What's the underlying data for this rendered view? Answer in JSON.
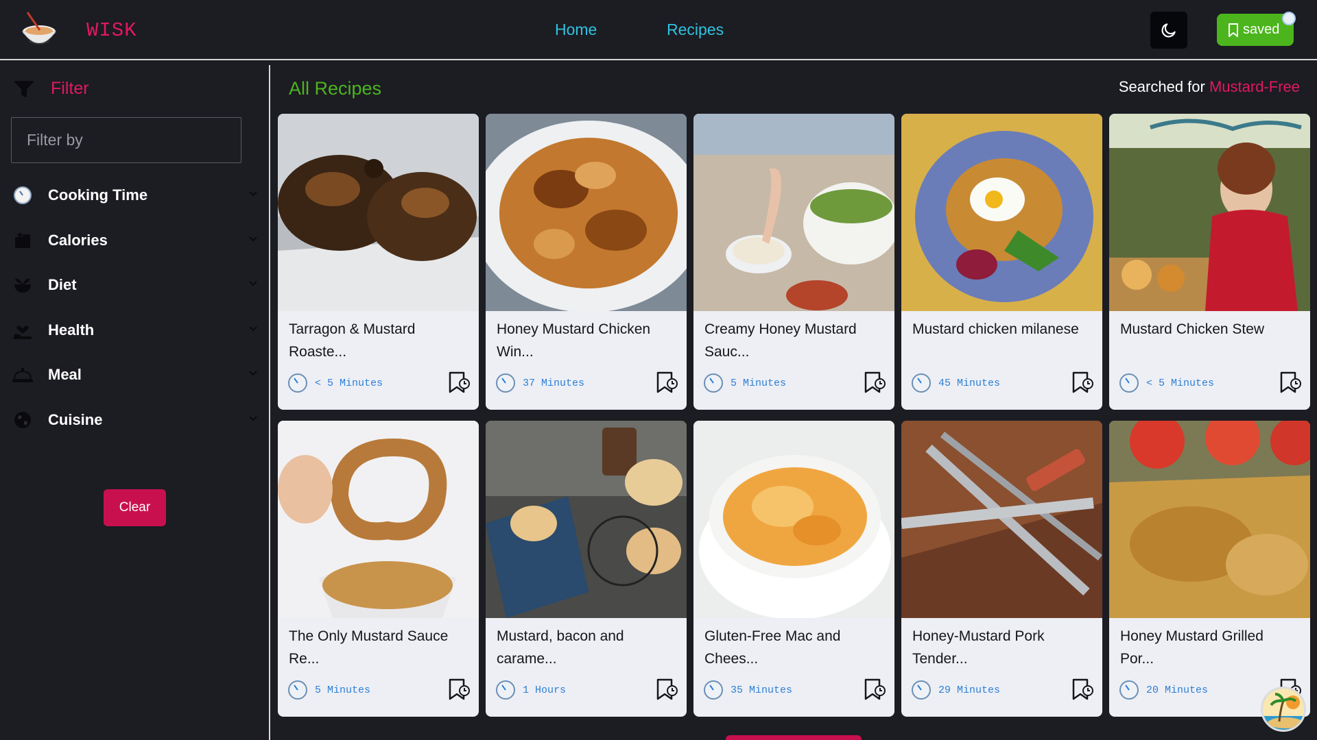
{
  "header": {
    "brand": "WISK",
    "nav": [
      {
        "label": "Home"
      },
      {
        "label": "Recipes"
      }
    ],
    "saved_label": "saved",
    "theme_icon": "moon-icon",
    "saved_icon": "bookmark-icon"
  },
  "sidebar": {
    "filter_title": "Filter",
    "filter_icon": "funnel-icon",
    "search_placeholder": "Filter by",
    "categories": [
      {
        "label": "Cooking Time",
        "icon": "clock-icon"
      },
      {
        "label": "Calories",
        "icon": "calories-icon"
      },
      {
        "label": "Diet",
        "icon": "diet-icon"
      },
      {
        "label": "Health",
        "icon": "health-icon"
      },
      {
        "label": "Meal",
        "icon": "meal-icon"
      },
      {
        "label": "Cuisine",
        "icon": "globe-icon"
      }
    ],
    "clear_label": "Clear"
  },
  "main": {
    "title": "All Recipes",
    "searched_prefix": "Searched for ",
    "searched_term": "Mustard-Free",
    "recipes": [
      {
        "title": "Tarragon & Mustard Roaste...",
        "time": "< 5 Minutes"
      },
      {
        "title": "Honey Mustard Chicken Win...",
        "time": "37 Minutes"
      },
      {
        "title": "Creamy Honey Mustard Sauc...",
        "time": "5 Minutes"
      },
      {
        "title": "Mustard chicken milanese",
        "time": "45 Minutes"
      },
      {
        "title": "Mustard Chicken Stew",
        "time": "< 5 Minutes"
      },
      {
        "title": "The Only Mustard Sauce Re...",
        "time": "5 Minutes"
      },
      {
        "title": "Mustard, bacon and carame...",
        "time": "1 Hours"
      },
      {
        "title": "Gluten-Free Mac and Chees...",
        "time": "35 Minutes"
      },
      {
        "title": "Honey-Mustard Pork Tender...",
        "time": "29 Minutes"
      },
      {
        "title": "Honey Mustard Grilled Por...",
        "time": "20 Minutes"
      }
    ]
  },
  "colors": {
    "background": "#1c1c23",
    "accent_pink": "#e0195f",
    "accent_green": "#4cb51d",
    "nav_cyan": "#2ec4e0",
    "time_blue": "#2e7fd6",
    "card": "#edeff4"
  }
}
